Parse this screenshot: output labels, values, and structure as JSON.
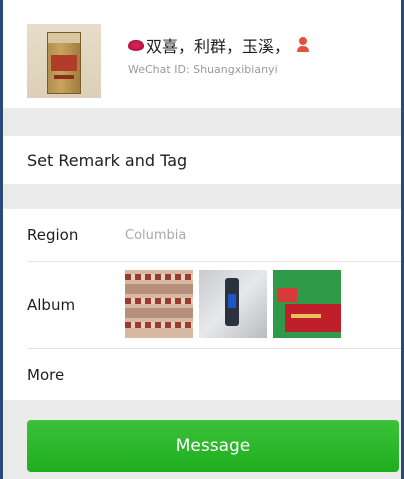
{
  "profile": {
    "name": "双喜，利群，玉溪，",
    "wechat_id": "WeChat ID: Shuangxibianyi"
  },
  "remark": {
    "label": "Set Remark and Tag"
  },
  "info": {
    "region_label": "Region",
    "region_value": "Columbia",
    "album_label": "Album",
    "more_label": "More"
  },
  "actions": {
    "message_label": "Message"
  },
  "colors": {
    "accent": "#1aad19",
    "background": "#ebebeb",
    "secondary_text": "#9a9a9a"
  },
  "icons": {
    "name_prefix": "lips-icon",
    "name_suffix": "person-icon"
  }
}
